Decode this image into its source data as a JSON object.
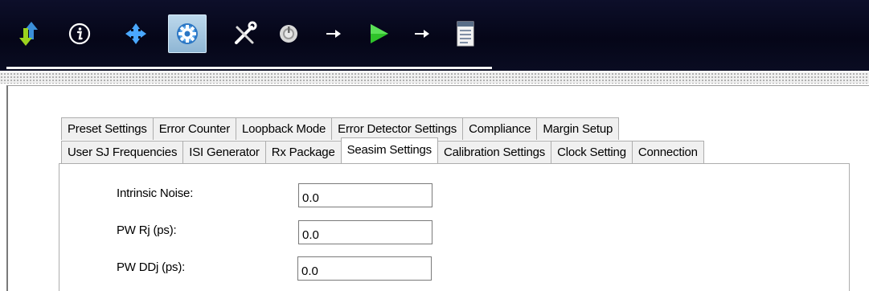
{
  "toolbar": {
    "buttons": [
      {
        "icon": "up-down-arrows-icon"
      },
      {
        "icon": "info-icon"
      },
      {
        "icon": "move-arrows-icon"
      },
      {
        "icon": "gear-icon",
        "active": true
      },
      {
        "icon": "tools-icon"
      },
      {
        "icon": "power-icon"
      },
      {
        "icon": "arrow-right-icon"
      },
      {
        "icon": "play-icon"
      },
      {
        "icon": "arrow-right-icon"
      },
      {
        "icon": "report-icon"
      }
    ]
  },
  "tabs": {
    "row1": [
      "Preset Settings",
      "Error Counter",
      "Loopback Mode",
      "Error Detector Settings",
      "Compliance",
      "Margin Setup"
    ],
    "row2": [
      "User SJ Frequencies",
      "ISI Generator",
      "Rx Package",
      "Seasim Settings",
      "Calibration Settings",
      "Clock Setting",
      "Connection"
    ],
    "selected": "Seasim Settings"
  },
  "form": {
    "intrinsic_noise": {
      "label": "Intrinsic Noise:",
      "value": "0.0"
    },
    "pw_rj": {
      "label": "PW Rj (ps):",
      "value": "0.0"
    },
    "pw_ddj": {
      "label": "PW DDj (ps):",
      "value": "0.0"
    }
  }
}
